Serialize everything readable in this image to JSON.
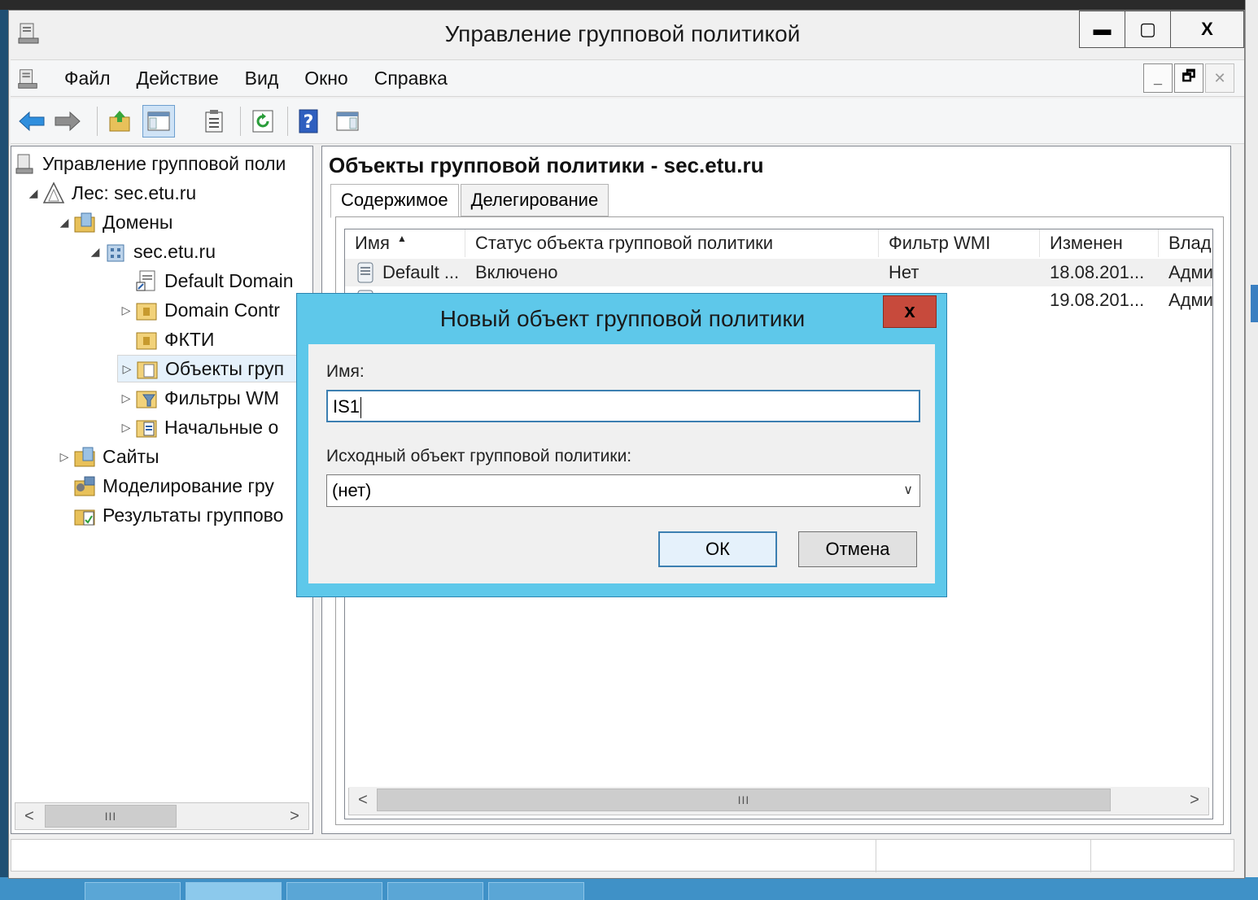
{
  "window": {
    "title": "Управление групповой политикой",
    "controls": {
      "minimize": "▬",
      "maximize": "▢",
      "close": "X"
    }
  },
  "menu": {
    "items": [
      "Файл",
      "Действие",
      "Вид",
      "Окно",
      "Справка"
    ],
    "mdi_controls": {
      "minimize": "_",
      "restore": "🗗",
      "close": "✕"
    }
  },
  "toolbar": {
    "icons": [
      "back-arrow-icon",
      "forward-arrow-icon",
      "up-folder-icon",
      "show-hide-tree-icon",
      "export-list-icon",
      "refresh-icon",
      "help-icon",
      "action-pane-icon"
    ]
  },
  "tree": {
    "items": [
      {
        "label": "Управление групповой поли",
        "expander": ""
      },
      {
        "label": "Лес: sec.etu.ru",
        "expander": "◢"
      },
      {
        "label": "Домены",
        "expander": "◢"
      },
      {
        "label": "sec.etu.ru",
        "expander": "◢"
      },
      {
        "label": "Default Domain",
        "expander": ""
      },
      {
        "label": "Domain Contr",
        "expander": "▷"
      },
      {
        "label": "ФКТИ",
        "expander": ""
      },
      {
        "label": "Объекты груп",
        "expander": "▷"
      },
      {
        "label": "Фильтры WM",
        "expander": "▷"
      },
      {
        "label": "Начальные о",
        "expander": "▷"
      },
      {
        "label": "Сайты",
        "expander": "▷"
      },
      {
        "label": "Моделирование гру",
        "expander": ""
      },
      {
        "label": "Результаты группово",
        "expander": ""
      }
    ]
  },
  "scrollbar": {
    "left": "<",
    "right": ">",
    "grip": "III"
  },
  "content": {
    "heading": "Объекты групповой политики - sec.etu.ru",
    "tabs": [
      "Содержимое",
      "Делегирование"
    ],
    "columns": [
      "Имя",
      "Статус объекта групповой политики",
      "Фильтр WMI",
      "Изменен",
      "Влад"
    ],
    "rows": [
      {
        "name": "Default ...",
        "status": "Включено",
        "wmi": "Нет",
        "modified": "18.08.201...",
        "owner": "Адми"
      },
      {
        "name": "",
        "status": "",
        "wmi": "",
        "modified": "19.08.201...",
        "owner": "Адми"
      }
    ]
  },
  "dialog": {
    "title": "Новый объект групповой политики",
    "close": "x",
    "name_label": "Имя:",
    "name_value": "IS1",
    "source_label": "Исходный объект групповой политики:",
    "source_value": "(нет)",
    "ok": "ОК",
    "cancel": "Отмена"
  },
  "colors": {
    "dialog_frame": "#5ec8ea",
    "dialog_close": "#c74a3c",
    "taskbar": "#3f91c7",
    "selection": "#e5f1fb"
  }
}
